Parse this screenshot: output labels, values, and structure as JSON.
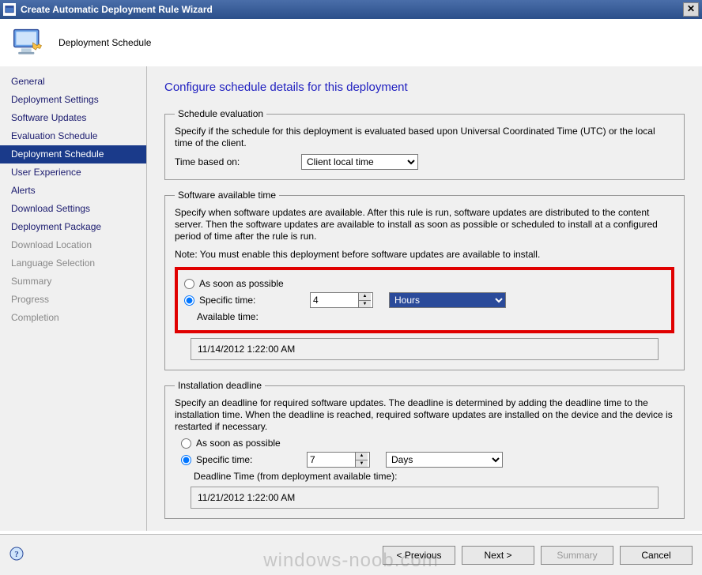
{
  "window": {
    "title": "Create Automatic Deployment Rule Wizard",
    "step_title": "Deployment Schedule"
  },
  "sidebar": {
    "items": [
      {
        "label": "General",
        "state": "normal"
      },
      {
        "label": "Deployment Settings",
        "state": "normal"
      },
      {
        "label": "Software Updates",
        "state": "normal"
      },
      {
        "label": "Evaluation Schedule",
        "state": "normal"
      },
      {
        "label": "Deployment Schedule",
        "state": "selected"
      },
      {
        "label": "User Experience",
        "state": "normal"
      },
      {
        "label": "Alerts",
        "state": "normal"
      },
      {
        "label": "Download Settings",
        "state": "normal"
      },
      {
        "label": "Deployment Package",
        "state": "normal"
      },
      {
        "label": "Download Location",
        "state": "disabled"
      },
      {
        "label": "Language Selection",
        "state": "disabled"
      },
      {
        "label": "Summary",
        "state": "disabled"
      },
      {
        "label": "Progress",
        "state": "disabled"
      },
      {
        "label": "Completion",
        "state": "disabled"
      }
    ]
  },
  "page": {
    "heading": "Configure schedule details for this deployment",
    "schedule_eval": {
      "legend": "Schedule evaluation",
      "desc": "Specify if the schedule for this deployment is evaluated based upon Universal Coordinated Time (UTC) or the local time of the client.",
      "time_based_on_label": "Time based on:",
      "time_based_on_value": "Client local time"
    },
    "available": {
      "legend": "Software available time",
      "desc": "Specify when software updates are available. After this rule is run, software updates are distributed to the content server. Then the software updates are available to install as soon as possible or scheduled to install at a configured period of time after the rule is run.",
      "note": "Note: You must enable this deployment before software updates are available to install.",
      "asap_label": "As soon as possible",
      "specific_label": "Specific time:",
      "specific_value": "4",
      "specific_unit": "Hours",
      "available_time_label": "Available time:",
      "available_time_value": "11/14/2012 1:22:00 AM"
    },
    "deadline": {
      "legend": "Installation deadline",
      "desc": "Specify an deadline for required software updates. The deadline is determined by adding the deadline time to the installation time. When the deadline is reached, required software updates are installed on the device and the device is restarted if necessary.",
      "asap_label": "As soon as possible",
      "specific_label": "Specific time:",
      "specific_value": "7",
      "specific_unit": "Days",
      "deadline_time_label": "Deadline Time (from deployment available time):",
      "deadline_time_value": "11/21/2012 1:22:00 AM"
    }
  },
  "footer": {
    "previous": "< Previous",
    "next": "Next >",
    "summary": "Summary",
    "cancel": "Cancel"
  },
  "watermark": "windows-noob.com"
}
